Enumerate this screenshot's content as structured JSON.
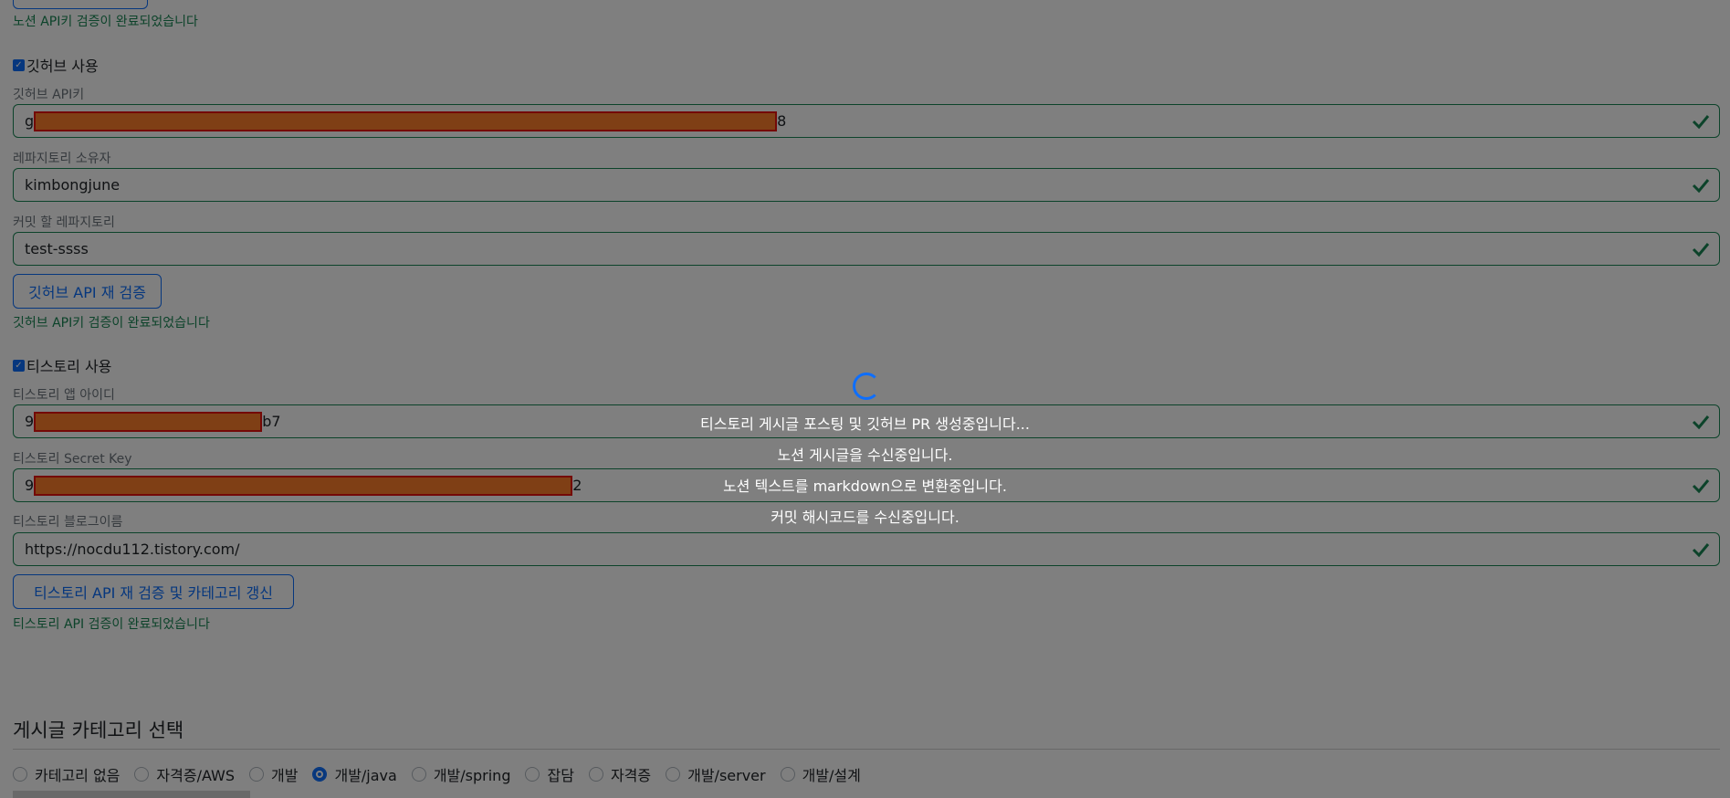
{
  "notion": {
    "status": "노션 API키 검증이 완료되었습니다"
  },
  "github": {
    "use_label": "깃허브 사용",
    "api_key_label": "깃허브 API키",
    "api_key_prefix": "g",
    "api_key_suffix": "8",
    "owner_label": "레파지토리 소유자",
    "owner_value": "kimbongjune",
    "repo_label": "커밋 할 레파지토리",
    "repo_value": "test-ssss",
    "reverify_button": "깃허브 API 재 검증",
    "status": "깃허브 API키 검증이 완료되었습니다"
  },
  "tistory": {
    "use_label": "티스토리 사용",
    "app_id_label": "티스토리 앱 아이디",
    "app_id_prefix": "9",
    "app_id_suffix": "b7",
    "secret_label": "티스토리 Secret Key",
    "secret_prefix": "9",
    "secret_suffix": "2",
    "blog_label": "티스토리 블로그이름",
    "blog_value": "https://nocdu112.tistory.com/",
    "reverify_button": "티스토리 API 재 검증 및 카테고리 갱신",
    "status": "티스토리 API 검증이 완료되었습니다"
  },
  "category": {
    "title": "게시글 카테고리 선택",
    "options": [
      "카테고리 없음",
      "자격증/AWS",
      "개발",
      "개발/java",
      "개발/spring",
      "잡담",
      "자격증",
      "개발/server",
      "개발/설계"
    ],
    "selected": "개발/java"
  },
  "loading": {
    "messages": [
      "티스토리 게시글 포스팅 및 깃허브 PR 생성중입니다...",
      "노션 게시글을 수신중입니다.",
      "노션 텍스트를 markdown으로 변환중입니다.",
      "커밋 해시코드를 수신중입니다."
    ]
  },
  "colors": {
    "valid": "#198754",
    "primary": "#0d6efd",
    "redaction_fill": "#ff7f2a",
    "redaction_border": "#e8130f"
  }
}
